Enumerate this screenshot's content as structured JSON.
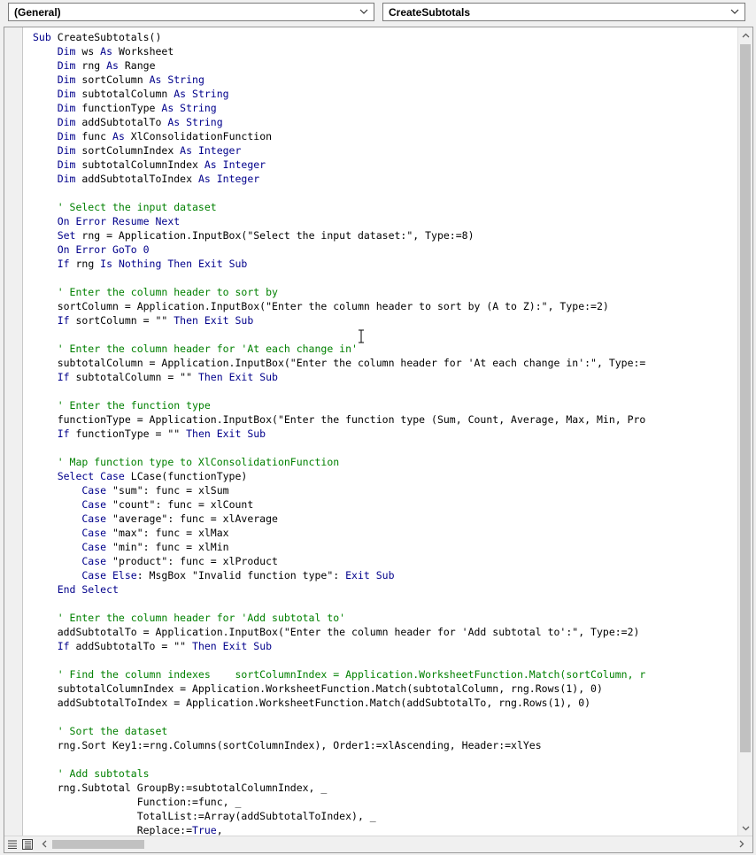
{
  "object_dropdown": {
    "value": "(General)"
  },
  "procedure_dropdown": {
    "value": "CreateSubtotals"
  },
  "icons": {
    "object_arrow": "chevron-down-icon",
    "procedure_arrow": "chevron-down-icon",
    "procedure_view": "procedure-view-icon",
    "module_view": "full-module-view-icon",
    "scroll_left": "chevron-left-icon",
    "scroll_right": "chevron-right-icon",
    "scroll_up": "chevron-up-icon",
    "scroll_down": "chevron-down-icon"
  },
  "colors": {
    "keyword": "#00008b",
    "comment": "#008000",
    "text": "#000000",
    "background": "#ffffff"
  },
  "code_lines": [
    [
      {
        "t": "Sub ",
        "k": "kw"
      },
      {
        "t": "CreateSubtotals()",
        "k": "tx"
      }
    ],
    [
      {
        "t": "    Dim ",
        "k": "kw"
      },
      {
        "t": "ws ",
        "k": "tx"
      },
      {
        "t": "As ",
        "k": "kw"
      },
      {
        "t": "Worksheet",
        "k": "tx"
      }
    ],
    [
      {
        "t": "    Dim ",
        "k": "kw"
      },
      {
        "t": "rng ",
        "k": "tx"
      },
      {
        "t": "As ",
        "k": "kw"
      },
      {
        "t": "Range",
        "k": "tx"
      }
    ],
    [
      {
        "t": "    Dim ",
        "k": "kw"
      },
      {
        "t": "sortColumn ",
        "k": "tx"
      },
      {
        "t": "As String",
        "k": "kw"
      }
    ],
    [
      {
        "t": "    Dim ",
        "k": "kw"
      },
      {
        "t": "subtotalColumn ",
        "k": "tx"
      },
      {
        "t": "As String",
        "k": "kw"
      }
    ],
    [
      {
        "t": "    Dim ",
        "k": "kw"
      },
      {
        "t": "functionType ",
        "k": "tx"
      },
      {
        "t": "As String",
        "k": "kw"
      }
    ],
    [
      {
        "t": "    Dim ",
        "k": "kw"
      },
      {
        "t": "addSubtotalTo ",
        "k": "tx"
      },
      {
        "t": "As String",
        "k": "kw"
      }
    ],
    [
      {
        "t": "    Dim ",
        "k": "kw"
      },
      {
        "t": "func ",
        "k": "tx"
      },
      {
        "t": "As ",
        "k": "kw"
      },
      {
        "t": "XlConsolidationFunction",
        "k": "tx"
      }
    ],
    [
      {
        "t": "    Dim ",
        "k": "kw"
      },
      {
        "t": "sortColumnIndex ",
        "k": "tx"
      },
      {
        "t": "As Integer",
        "k": "kw"
      }
    ],
    [
      {
        "t": "    Dim ",
        "k": "kw"
      },
      {
        "t": "subtotalColumnIndex ",
        "k": "tx"
      },
      {
        "t": "As Integer",
        "k": "kw"
      }
    ],
    [
      {
        "t": "    Dim ",
        "k": "kw"
      },
      {
        "t": "addSubtotalToIndex ",
        "k": "tx"
      },
      {
        "t": "As Integer",
        "k": "kw"
      }
    ],
    [],
    [
      {
        "t": "    ' Select the input dataset",
        "k": "cm"
      }
    ],
    [
      {
        "t": "    On Error Resume Next",
        "k": "kw"
      }
    ],
    [
      {
        "t": "    Set ",
        "k": "kw"
      },
      {
        "t": "rng = Application.InputBox(\"Select the input dataset:\", Type:=8)",
        "k": "tx"
      }
    ],
    [
      {
        "t": "    On Error GoTo 0",
        "k": "kw"
      }
    ],
    [
      {
        "t": "    If ",
        "k": "kw"
      },
      {
        "t": "rng ",
        "k": "tx"
      },
      {
        "t": "Is Nothing Then Exit Sub",
        "k": "kw"
      }
    ],
    [],
    [
      {
        "t": "    ' Enter the column header to sort by",
        "k": "cm"
      }
    ],
    [
      {
        "t": "    sortColumn = Application.InputBox(\"Enter the column header to sort by (A to Z):\", Type:=2)",
        "k": "tx"
      }
    ],
    [
      {
        "t": "    If ",
        "k": "kw"
      },
      {
        "t": "sortColumn = \"\" ",
        "k": "tx"
      },
      {
        "t": "Then Exit Sub",
        "k": "kw"
      }
    ],
    [],
    [
      {
        "t": "    ' Enter the column header for 'At each change in'",
        "k": "cm"
      }
    ],
    [
      {
        "t": "    subtotalColumn = Application.InputBox(\"Enter the column header for 'At each change in':\", Type:=",
        "k": "tx"
      }
    ],
    [
      {
        "t": "    If ",
        "k": "kw"
      },
      {
        "t": "subtotalColumn = \"\" ",
        "k": "tx"
      },
      {
        "t": "Then Exit Sub",
        "k": "kw"
      }
    ],
    [],
    [
      {
        "t": "    ' Enter the function type",
        "k": "cm"
      }
    ],
    [
      {
        "t": "    functionType = Application.InputBox(\"Enter the function type (Sum, Count, Average, Max, Min, Pro",
        "k": "tx"
      }
    ],
    [
      {
        "t": "    If ",
        "k": "kw"
      },
      {
        "t": "functionType = \"\" ",
        "k": "tx"
      },
      {
        "t": "Then Exit Sub",
        "k": "kw"
      }
    ],
    [],
    [
      {
        "t": "    ' Map function type to XlConsolidationFunction",
        "k": "cm"
      }
    ],
    [
      {
        "t": "    Select Case ",
        "k": "kw"
      },
      {
        "t": "LCase(functionType)",
        "k": "tx"
      }
    ],
    [
      {
        "t": "        Case ",
        "k": "kw"
      },
      {
        "t": "\"sum\": func = xlSum",
        "k": "tx"
      }
    ],
    [
      {
        "t": "        Case ",
        "k": "kw"
      },
      {
        "t": "\"count\": func = xlCount",
        "k": "tx"
      }
    ],
    [
      {
        "t": "        Case ",
        "k": "kw"
      },
      {
        "t": "\"average\": func = xlAverage",
        "k": "tx"
      }
    ],
    [
      {
        "t": "        Case ",
        "k": "kw"
      },
      {
        "t": "\"max\": func = xlMax",
        "k": "tx"
      }
    ],
    [
      {
        "t": "        Case ",
        "k": "kw"
      },
      {
        "t": "\"min\": func = xlMin",
        "k": "tx"
      }
    ],
    [
      {
        "t": "        Case ",
        "k": "kw"
      },
      {
        "t": "\"product\": func = xlProduct",
        "k": "tx"
      }
    ],
    [
      {
        "t": "        Case Else",
        "k": "kw"
      },
      {
        "t": ": MsgBox \"Invalid function type\": ",
        "k": "tx"
      },
      {
        "t": "Exit Sub",
        "k": "kw"
      }
    ],
    [
      {
        "t": "    End Select",
        "k": "kw"
      }
    ],
    [],
    [
      {
        "t": "    ' Enter the column header for 'Add subtotal to'",
        "k": "cm"
      }
    ],
    [
      {
        "t": "    addSubtotalTo = Application.InputBox(\"Enter the column header for 'Add subtotal to':\", Type:=2)",
        "k": "tx"
      }
    ],
    [
      {
        "t": "    If ",
        "k": "kw"
      },
      {
        "t": "addSubtotalTo = \"\" ",
        "k": "tx"
      },
      {
        "t": "Then Exit Sub",
        "k": "kw"
      }
    ],
    [],
    [
      {
        "t": "    ' Find the column indexes    sortColumnIndex = Application.WorksheetFunction.Match(sortColumn, r",
        "k": "cm"
      }
    ],
    [
      {
        "t": "    subtotalColumnIndex = Application.WorksheetFunction.Match(subtotalColumn, rng.Rows(1), 0)",
        "k": "tx"
      }
    ],
    [
      {
        "t": "    addSubtotalToIndex = Application.WorksheetFunction.Match(addSubtotalTo, rng.Rows(1), 0)",
        "k": "tx"
      }
    ],
    [],
    [
      {
        "t": "    ' Sort the dataset",
        "k": "cm"
      }
    ],
    [
      {
        "t": "    rng.Sort Key1:=rng.Columns(sortColumnIndex), Order1:=xlAscending, Header:=xlYes",
        "k": "tx"
      }
    ],
    [],
    [
      {
        "t": "    ' Add subtotals",
        "k": "cm"
      }
    ],
    [
      {
        "t": "    rng.Subtotal GroupBy:=subtotalColumnIndex, _",
        "k": "tx"
      }
    ],
    [
      {
        "t": "                 Function:=func, _",
        "k": "tx"
      }
    ],
    [
      {
        "t": "                 TotalList:=Array(addSubtotalToIndex), _",
        "k": "tx"
      }
    ],
    [
      {
        "t": "                 Replace:=",
        "k": "tx"
      },
      {
        "t": "True",
        "k": "kw"
      },
      {
        "t": ", _",
        "k": "tx"
      }
    ]
  ]
}
